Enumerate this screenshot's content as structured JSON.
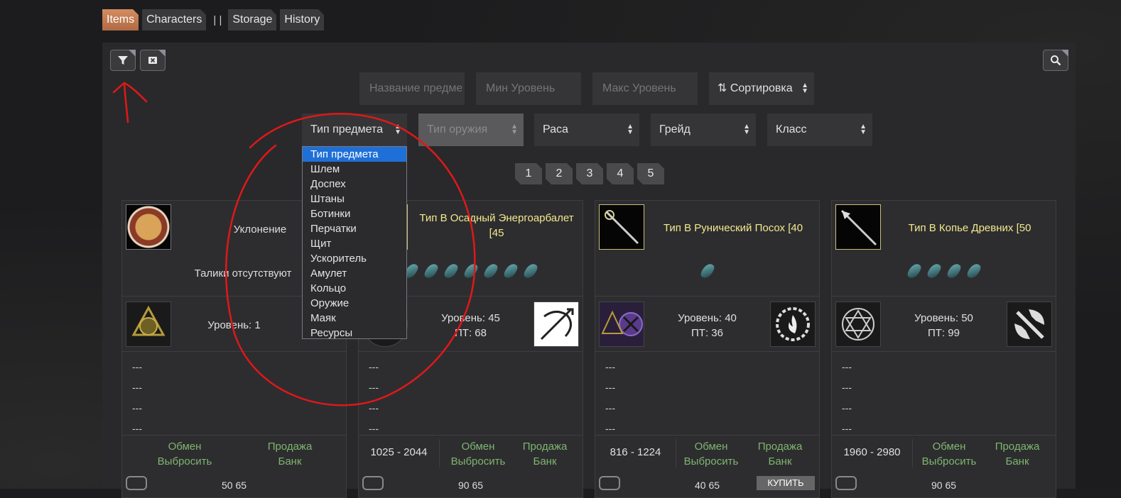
{
  "tabs": [
    {
      "label": "Items",
      "active": true
    },
    {
      "label": "Characters",
      "active": false
    },
    {
      "label": "Storage",
      "active": false
    },
    {
      "label": "History",
      "active": false
    }
  ],
  "tab_separator": "| |",
  "filters": {
    "name_placeholder": "Название предмета",
    "min_level_placeholder": "Мин Уровень",
    "max_level_placeholder": "Макс Уровень",
    "sort_label": "⇅ Сортировка",
    "item_type_label": "Тип предмета",
    "weapon_type_label": "Тип оружия",
    "race_label": "Раса",
    "grade_label": "Грейд",
    "class_label": "Класс"
  },
  "item_type_options": [
    "Тип предмета",
    "Шлем",
    "Доспех",
    "Штаны",
    "Ботинки",
    "Перчатки",
    "Щит",
    "Ускоритель",
    "Амулет",
    "Кольцо",
    "Оружие",
    "Маяк",
    "Ресурсы"
  ],
  "pages": [
    "1",
    "2",
    "3",
    "4",
    "5"
  ],
  "cards": [
    {
      "title": "Уклонение",
      "subtitle": "Талики отсутствуют",
      "talic_count": 0,
      "level": "Уровень: 1",
      "pt": "",
      "price": "",
      "action1": "Обмен",
      "action2": "Продажа",
      "action3": "Выбросить",
      "action4": "Банк",
      "dashes": [
        "---",
        "---",
        "---",
        "---"
      ],
      "footer": "50 65"
    },
    {
      "title": "Тип В Осадный Энергоарбалет [45",
      "subtitle": "",
      "talic_count": 7,
      "level": "Уровень: 45",
      "pt": "ПТ: 68",
      "price": "1025 - 2044",
      "action1": "Обмен",
      "action2": "Продажа",
      "action3": "Выбросить",
      "action4": "Банк",
      "dashes": [
        "---",
        "---",
        "---",
        "---"
      ],
      "footer": "90 65"
    },
    {
      "title": "Тип В Рунический Посох [40",
      "subtitle": "",
      "talic_count": 1,
      "level": "Уровень: 40",
      "pt": "ПТ: 36",
      "price": "816 - 1224",
      "action1": "Обмен",
      "action2": "Продажа",
      "action3": "Выбросить",
      "action4": "Банк",
      "dashes": [
        "---",
        "---",
        "---",
        "---"
      ],
      "footer": "40 65",
      "buy_label": "КУПИТЬ"
    },
    {
      "title": "Тип В Копье Древних [50",
      "subtitle": "",
      "talic_count": 4,
      "level": "Уровень: 50",
      "pt": "ПТ: 99",
      "price": "1960 - 2980",
      "action1": "Обмен",
      "action2": "Продажа",
      "action3": "Выбросить",
      "action4": "Банк",
      "dashes": [
        "---",
        "---",
        "---",
        "---"
      ],
      "footer": "90 65"
    }
  ],
  "colors": {
    "accent": "#c77a50",
    "item_title": "#f3e98c",
    "action_green": "#7fb56e",
    "annotation_red": "#e01818",
    "select_highlight": "#1f6fd8"
  }
}
